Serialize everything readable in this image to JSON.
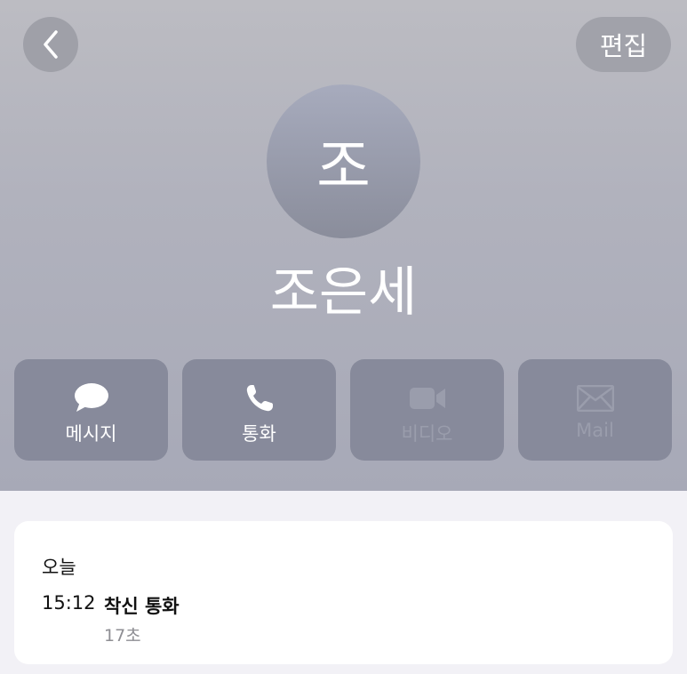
{
  "header": {
    "back_icon": "chevron-left-icon",
    "edit_label": "편집",
    "avatar_initial": "조",
    "contact_name": "조은세"
  },
  "actions": [
    {
      "icon": "message-bubble-icon",
      "label": "메시지",
      "enabled": true
    },
    {
      "icon": "phone-icon",
      "label": "통화",
      "enabled": true
    },
    {
      "icon": "video-camera-icon",
      "label": "비디오",
      "enabled": false
    },
    {
      "icon": "mail-icon",
      "label": "Mail",
      "enabled": false
    }
  ],
  "recents": {
    "day": "오늘",
    "time": "15:12",
    "call_type": "착신 통화",
    "duration": "17초"
  }
}
